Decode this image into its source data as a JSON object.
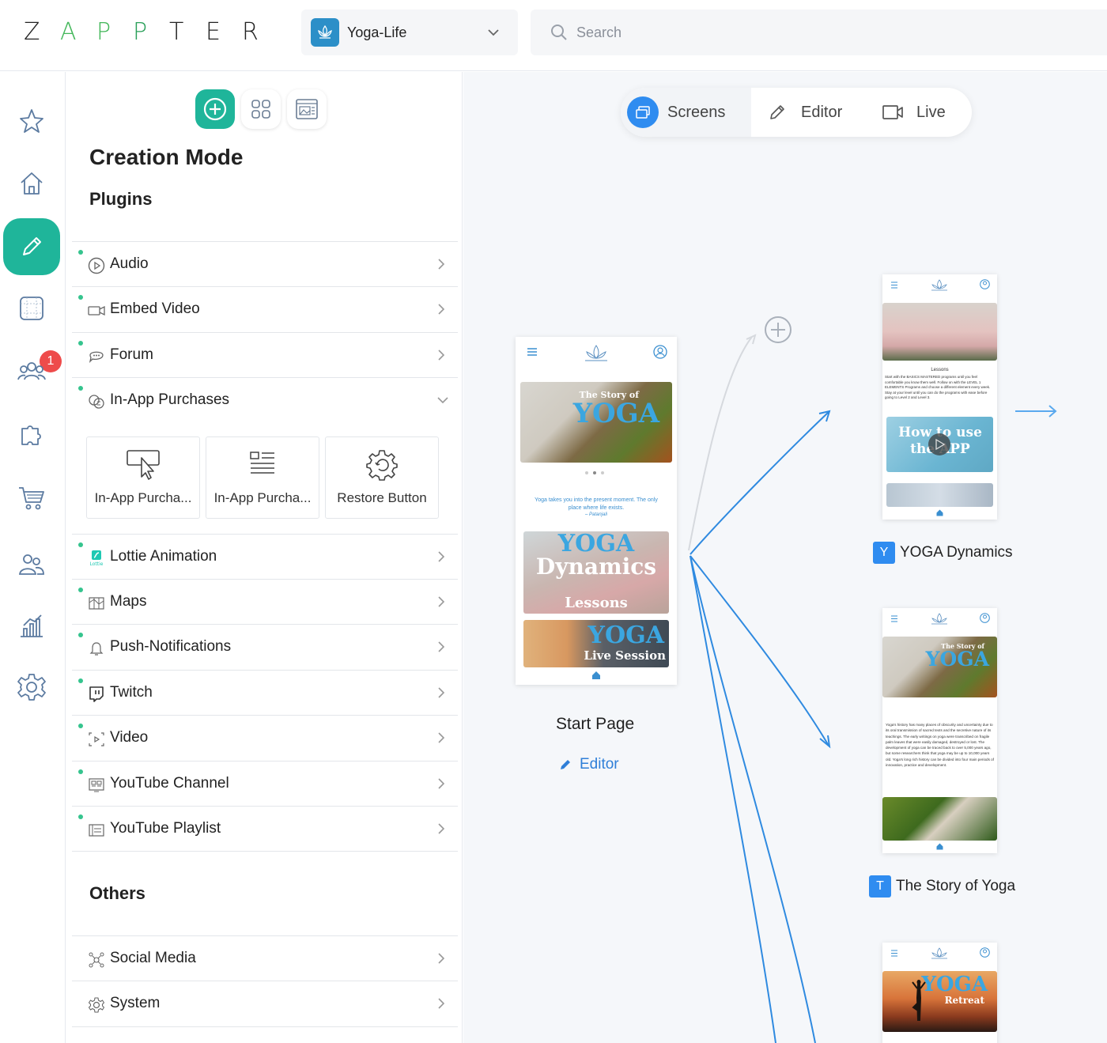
{
  "header": {
    "logo_letters": [
      "Z",
      "A",
      "P",
      "P",
      "T",
      "E",
      "R"
    ],
    "logo_colors": [
      "#222222",
      "#43b75a",
      "#43b75a",
      "#2aa05a",
      "#222222",
      "#222222",
      "#222222"
    ],
    "app_name": "Yoga-Life",
    "search_placeholder": "Search"
  },
  "rail": {
    "items": [
      "favorites",
      "home",
      "creation-mode",
      "templates",
      "users",
      "plugins",
      "shop",
      "team",
      "analytics",
      "settings"
    ],
    "active": "creation-mode",
    "badge": "1"
  },
  "panel": {
    "title": "Creation Mode",
    "plugins_heading": "Plugins",
    "plugins": [
      {
        "label": "Audio",
        "icon": "play-circle-icon"
      },
      {
        "label": "Embed Video",
        "icon": "video-camera-icon"
      },
      {
        "label": "Forum",
        "icon": "chat-bubble-icon"
      },
      {
        "label": "In-App Purchases",
        "icon": "coins-icon",
        "expanded": true
      }
    ],
    "sub_items": [
      "In-App Purcha...",
      "In-App Purcha...",
      "Restore Button"
    ],
    "plugins_after": [
      {
        "label": "Lottie Animation",
        "icon": "lottie-icon"
      },
      {
        "label": "Maps",
        "icon": "map-icon"
      },
      {
        "label": "Push-Notifications",
        "icon": "bell-icon"
      },
      {
        "label": "Twitch",
        "icon": "twitch-icon"
      },
      {
        "label": "Video",
        "icon": "video-frame-icon"
      },
      {
        "label": "YouTube Channel",
        "icon": "youtube-channel-icon"
      },
      {
        "label": "YouTube Playlist",
        "icon": "youtube-playlist-icon"
      }
    ],
    "others_heading": "Others",
    "others": [
      {
        "label": "Social Media",
        "icon": "social-icon"
      },
      {
        "label": "System",
        "icon": "gear-icon"
      }
    ]
  },
  "canvas": {
    "tabs": [
      {
        "label": "Screens",
        "active": true
      },
      {
        "label": "Editor",
        "active": false
      },
      {
        "label": "Live",
        "active": false
      }
    ],
    "start_screen": {
      "label": "Start Page",
      "editor_link": "Editor",
      "hero_title_small": "The Story of",
      "hero_title_big": "YOGA",
      "quote": "Yoga takes you into the present moment. The only place where life exists.",
      "quote_author": "– Patanjali",
      "card1_big": "YOGA",
      "card1_mid": "Dynamics",
      "card1_small": "Lessons",
      "card2_big": "YOGA",
      "card2_small": "Live Session"
    },
    "screens": [
      {
        "letter": "Y",
        "label": "YOGA Dynamics",
        "heading": "Lessons",
        "body": "Start with the BASICS MASTERED programs until you feel comfortable you know them well. Follow on with the LEVEL 1 ELEMENTS Programs and choose a different element every week. Stay at your level until you can do the programs with ease before going to Level 2 and Level 3.",
        "banner": "How to use the APP"
      },
      {
        "letter": "T",
        "label": "The Story of Yoga",
        "hero_small": "The Story of",
        "hero_big": "YOGA",
        "body": "Yoga's history has many places of obscurity and uncertainty due to its oral transmission of sacred texts and the secretive nature of its teachings. The early writings on yoga were transcribed on fragile palm leaves that were easily damaged, destroyed or lost. The development of yoga can be traced back to over 5,000 years ago, but some researchers think that yoga may be up to 10,000 years old. Yoga's long rich history can be divided into four main periods of innovation, practice and development."
      },
      {
        "hero_big": "YOGA",
        "hero_small": "Retreat"
      }
    ]
  },
  "colors": {
    "accent_green": "#1fb59a",
    "accent_blue": "#2f8cf0",
    "badge_red": "#ee4b4b",
    "connector_blue": "#2f8ae0"
  }
}
